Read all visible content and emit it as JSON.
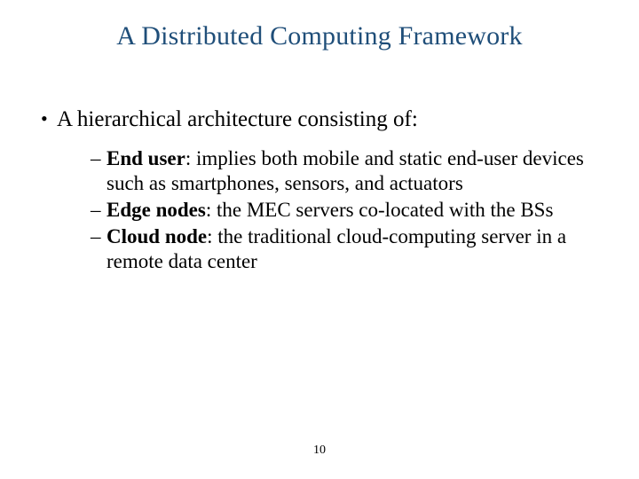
{
  "title": "A Distributed Computing Framework",
  "intro": "A hierarchical architecture consisting of:",
  "items": [
    {
      "label": "End user",
      "desc": ": implies both mobile and static end-user devices such as smartphones, sensors, and actuators"
    },
    {
      "label": "Edge nodes",
      "desc": ": the MEC servers co-located with the BSs"
    },
    {
      "label": "Cloud node",
      "desc": ": the traditional cloud-computing server in a remote data center"
    }
  ],
  "page_number": "10"
}
